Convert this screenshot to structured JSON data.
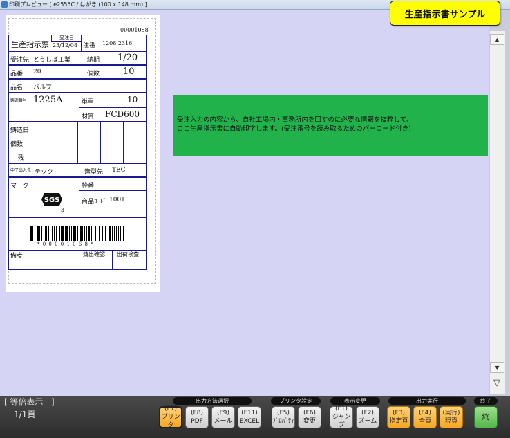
{
  "window": {
    "title": "印刷プレビュー [ e2555C / はがき (100 x 148 mm) ]"
  },
  "stamp": {
    "label": "生産指示書サンプル"
  },
  "form": {
    "serial": "00001088",
    "title": "生産指示票",
    "order_date_label": "受注日",
    "order_date": "23/12/08",
    "order_no_label": "注番",
    "order_no": "1208 2316",
    "customer_label": "受注先",
    "customer": "とうしば工業",
    "due_label": "納期",
    "due": "1/20",
    "part_no_label": "品番",
    "part_no": "20",
    "qty_label": "個数",
    "qty": "10",
    "part_name_label": "品名",
    "part_name": "バルブ",
    "casting_no_label": "鋳造番号",
    "casting_no": "1225A",
    "unit_weight_label": "単重",
    "unit_weight": "10",
    "material_label": "材質",
    "material": "FCD600",
    "cast_date_label": "鋳造日",
    "count_label": "個数",
    "remain_label": "残",
    "maker_label": "中子出入先",
    "maker": "テック",
    "mold_label": "造型先",
    "mold": "TEC",
    "mark_label": "マーク",
    "frame_no_label": "枠番",
    "mark_logo": "SGS",
    "mark_num": "3",
    "product_code_label": "商品ｺｰﾄﾞ",
    "product_code": "1001",
    "barcode_text": "* 0 0 0 0 1 0 6 8 *",
    "remarks_label": "備考",
    "check1_label": "鋳出確認",
    "check2_label": "出荷検査"
  },
  "note": {
    "line1": "受注入力の内容から、自社工場内・事務所内を回すのに必要な情報を抜粋して、",
    "line2": "ここ生産指示書に自動印字します。(受注番号を読み取るためのバーコード付き)"
  },
  "status": {
    "zoom": "[ 等倍表示   ]",
    "page": "1/1頁"
  },
  "groups": {
    "output_method": "出力方法選択",
    "printer_settings": "プリンタ設定",
    "display_change": "表示変更",
    "output_exec": "出力実行",
    "end": "終了"
  },
  "keys": [
    {
      "code": "(F7)",
      "label": "プリンタ"
    },
    {
      "code": "(F8)",
      "label": "PDF"
    },
    {
      "code": "(F9)",
      "label": "メール"
    },
    {
      "code": "(F11)",
      "label": "EXCEL"
    },
    {
      "code": "(F5)",
      "label": "ﾌﾟﾛﾊﾟﾃｨ"
    },
    {
      "code": "(F6)",
      "label": "変更"
    },
    {
      "code": "(F1)",
      "label": "ジャンプ"
    },
    {
      "code": "(F2)",
      "label": "ズーム"
    },
    {
      "code": "(F3)",
      "label": "指定頁"
    },
    {
      "code": "(F4)",
      "label": "全頁"
    },
    {
      "code": "(実行)",
      "label": "現頁"
    },
    {
      "code": "",
      "label": "終"
    }
  ],
  "scroll": {
    "up_icon": "▲",
    "down_icon": "▼",
    "end_icon": "▽"
  }
}
